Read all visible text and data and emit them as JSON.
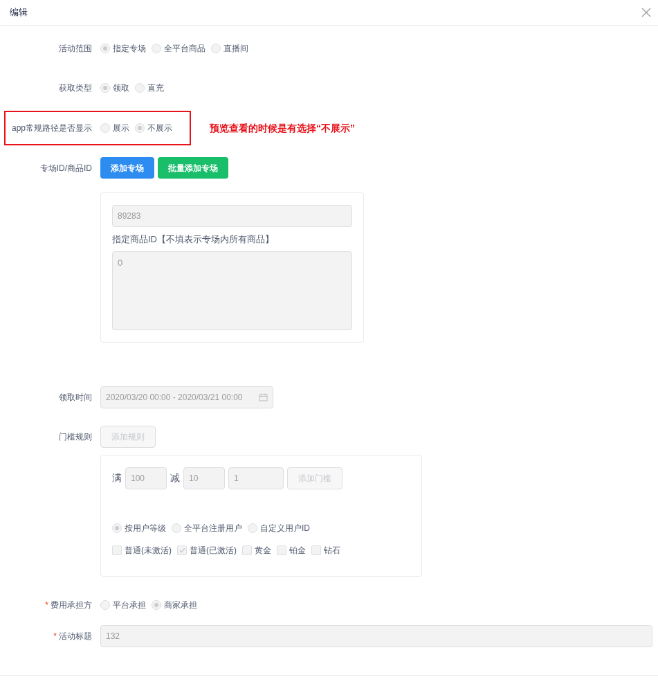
{
  "dialog": {
    "title": "编辑",
    "closable": true
  },
  "scope": {
    "label": "活动范围",
    "options": [
      {
        "label": "指定专场",
        "selected": true
      },
      {
        "label": "全平台商品",
        "selected": false
      },
      {
        "label": "直播间",
        "selected": false
      }
    ]
  },
  "acquire_type": {
    "label": "获取类型",
    "options": [
      {
        "label": "领取",
        "selected": true
      },
      {
        "label": "直充",
        "selected": false
      }
    ]
  },
  "app_path": {
    "label": "app常规路径是否显示",
    "highlighted": true,
    "note": "预览查看的时候是有选择“不展示”",
    "options": [
      {
        "label": "展示",
        "selected": false
      },
      {
        "label": "不展示",
        "selected": true
      }
    ]
  },
  "ids": {
    "label": "专场ID/商品ID",
    "buttons": [
      {
        "label": "添加专场",
        "color": "#2d8cf0"
      },
      {
        "label": "批量添加专场",
        "color": "#19be6b"
      }
    ],
    "venue_id": "89283",
    "goods_label": "指定商品ID【不填表示专场内所有商品】",
    "goods_ids": "0"
  },
  "time": {
    "label": "领取时间",
    "value": "2020/03/20 00:00 - 2020/03/21 00:00"
  },
  "rules": {
    "label": "门槛规则",
    "add_button": "添加规则",
    "full_label": "满",
    "full_value": "100",
    "minus_label": "减",
    "minus_value": "10",
    "count_value": "1",
    "add_threshold": "添加门槛",
    "user_options": [
      {
        "label": "按用户等级",
        "selected": true
      },
      {
        "label": "全平台注册用户",
        "selected": false
      },
      {
        "label": "自定义用户ID",
        "selected": false
      }
    ],
    "levels": [
      {
        "label": "普通(未激活)",
        "checked": false
      },
      {
        "label": "普通(已激活)",
        "checked": true
      },
      {
        "label": "黄金",
        "checked": false
      },
      {
        "label": "铂金",
        "checked": false
      },
      {
        "label": "钻石",
        "checked": false
      }
    ]
  },
  "cost": {
    "label": "费用承担方",
    "required_mark": "*",
    "options": [
      {
        "label": "平台承担",
        "selected": false
      },
      {
        "label": "商家承担",
        "selected": true
      }
    ]
  },
  "title_field": {
    "label": "活动标题",
    "required_mark": "*",
    "value": "132"
  }
}
